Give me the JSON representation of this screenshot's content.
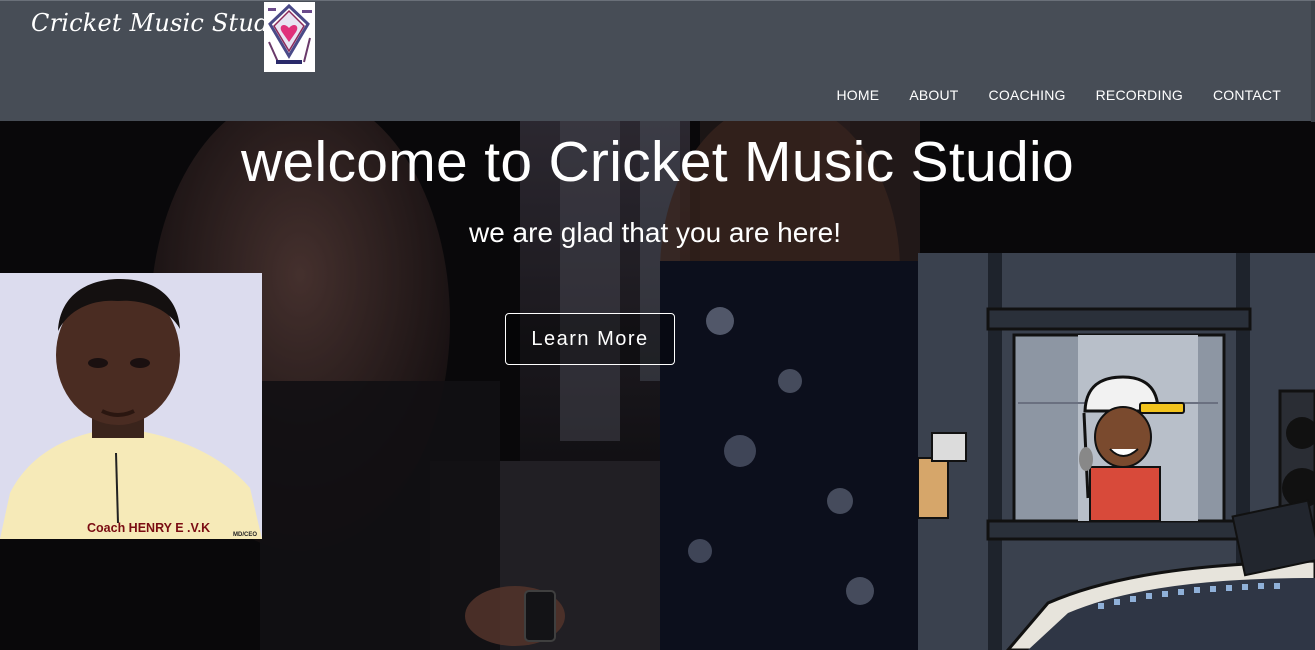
{
  "site": {
    "brand": "Cricket Music Studio",
    "accent_color": "#474d56"
  },
  "nav": {
    "items": [
      {
        "label": "HOME"
      },
      {
        "label": "ABOUT"
      },
      {
        "label": "COACHING"
      },
      {
        "label": "RECORDING"
      },
      {
        "label": "CONTACT"
      }
    ]
  },
  "hero": {
    "title": "welcome to Cricket Music Studio",
    "subtitle": "we are glad that you are here!",
    "button_label": "Learn More"
  },
  "coach": {
    "caption": "Coach HENRY E .V.K",
    "subcaption": "MD/CEO"
  },
  "icons": {
    "logo": "studio-logo-icon"
  }
}
